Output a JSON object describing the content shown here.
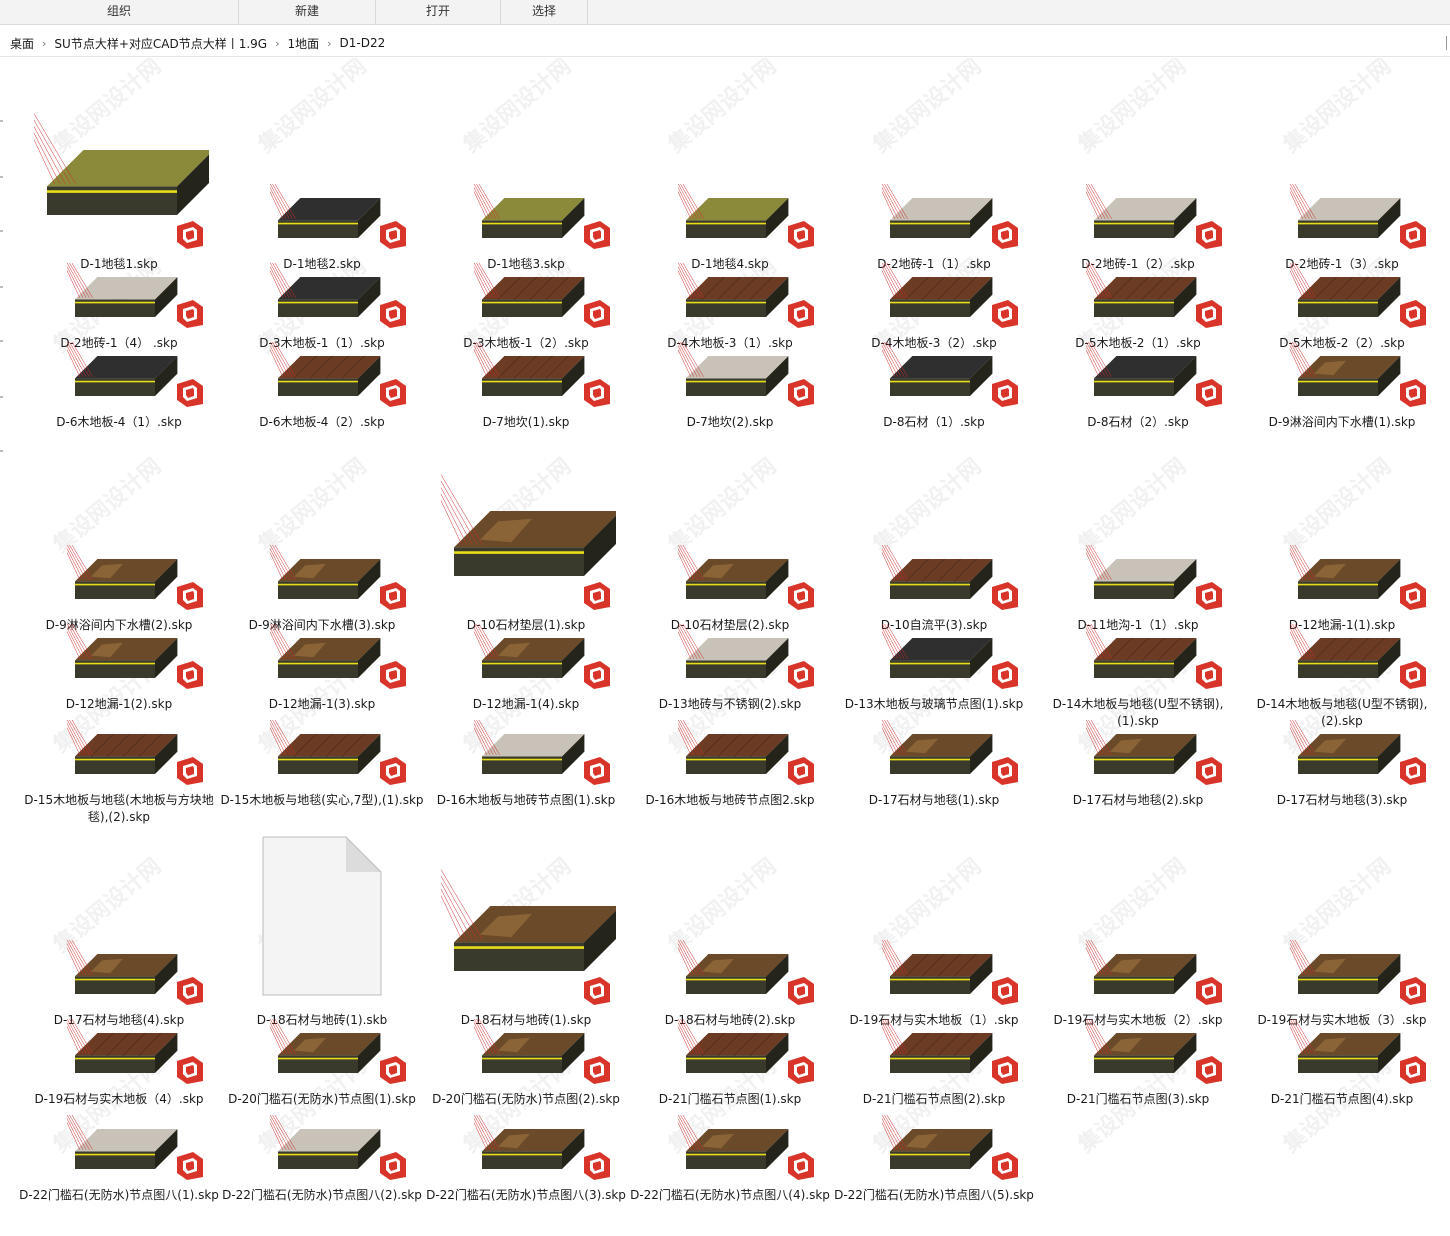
{
  "toolbar": {
    "items": [
      "组织",
      "新建",
      "打开",
      "选择"
    ]
  },
  "breadcrumb": [
    "桌面",
    "SU节点大样+对应CAD节点大样丨1.9G",
    "1地面",
    "D1-D22"
  ],
  "colors": {
    "concrete": "#3a3a2c",
    "insulation": "#e8dd18",
    "marble": "#6b4a2a",
    "wood": "#6b3b24",
    "carpet": "#8a8a3a",
    "tile": "#c8c2b8",
    "leader_lines": "#d12b2b",
    "sketchup_red": "#d9342a"
  },
  "files": [
    {
      "name": "D-1地毯1.skp",
      "thumb": "carpet"
    },
    {
      "name": "D-1地毯2.skp",
      "thumb": "dark"
    },
    {
      "name": "D-1地毯3.skp",
      "thumb": "carpet"
    },
    {
      "name": "D-1地毯4.skp",
      "thumb": "carpet"
    },
    {
      "name": "D-2地砖-1（1）.skp",
      "thumb": "tile"
    },
    {
      "name": "D-2地砖-1（2）.skp",
      "thumb": "tile"
    },
    {
      "name": "D-2地砖-1（3）.skp",
      "thumb": "tile"
    },
    {
      "name": "D-2地砖-1（4） .skp",
      "thumb": "tile"
    },
    {
      "name": "D-3木地板-1（1）.skp",
      "thumb": "dark"
    },
    {
      "name": "D-3木地板-1（2）.skp",
      "thumb": "wood"
    },
    {
      "name": "D-4木地板-3（1）.skp",
      "thumb": "wood"
    },
    {
      "name": "D-4木地板-3（2）.skp",
      "thumb": "wood"
    },
    {
      "name": "D-5木地板-2（1）.skp",
      "thumb": "wood"
    },
    {
      "name": "D-5木地板-2（2）.skp",
      "thumb": "wood"
    },
    {
      "name": "D-6木地板-4（1）.skp",
      "thumb": "dark"
    },
    {
      "name": "D-6木地板-4（2）.skp",
      "thumb": "wood"
    },
    {
      "name": "D-7地坎(1).skp",
      "thumb": "wood"
    },
    {
      "name": "D-7地坎(2).skp",
      "thumb": "tile"
    },
    {
      "name": "D-8石材（1）.skp",
      "thumb": "dark"
    },
    {
      "name": "D-8石材（2）.skp",
      "thumb": "dark"
    },
    {
      "name": "D-9淋浴间内下水槽(1).skp",
      "thumb": "marble"
    },
    {
      "name": "D-9淋浴间内下水槽(2).skp",
      "thumb": "marble"
    },
    {
      "name": "D-9淋浴间内下水槽(3).skp",
      "thumb": "marble"
    },
    {
      "name": "D-10石材垫层(1).skp",
      "thumb": "marble"
    },
    {
      "name": "D-10石材垫层(2).skp",
      "thumb": "marble"
    },
    {
      "name": "D-10自流平(3).skp",
      "thumb": "wood"
    },
    {
      "name": "D-11地沟-1（1）.skp",
      "thumb": "tile"
    },
    {
      "name": "D-12地漏-1(1).skp",
      "thumb": "marble"
    },
    {
      "name": "D-12地漏-1(2).skp",
      "thumb": "marble"
    },
    {
      "name": "D-12地漏-1(3).skp",
      "thumb": "marble"
    },
    {
      "name": "D-12地漏-1(4).skp",
      "thumb": "marble"
    },
    {
      "name": "D-13地砖与不锈钢(2).skp",
      "thumb": "tile"
    },
    {
      "name": "D-13木地板与玻璃节点图(1).skp",
      "thumb": "dark"
    },
    {
      "name": "D-14木地板与地毯(U型不锈钢),(1).skp",
      "thumb": "wood"
    },
    {
      "name": "D-14木地板与地毯(U型不锈钢),(2).skp",
      "thumb": "wood"
    },
    {
      "name": "D-15木地板与地毯(木地板与方块地毯),(2).skp",
      "thumb": "wood"
    },
    {
      "name": "D-15木地板与地毯(实心,7型),(1).skp",
      "thumb": "wood"
    },
    {
      "name": "D-16木地板与地砖节点图(1).skp",
      "thumb": "tile"
    },
    {
      "name": "D-16木地板与地砖节点图2.skp",
      "thumb": "wood"
    },
    {
      "name": "D-17石材与地毯(1).skp",
      "thumb": "marble"
    },
    {
      "name": "D-17石材与地毯(2).skp",
      "thumb": "marble"
    },
    {
      "name": "D-17石材与地毯(3).skp",
      "thumb": "marble"
    },
    {
      "name": "D-17石材与地毯(4).skp",
      "thumb": "marble"
    },
    {
      "name": "D-18石材与地砖(1).skb",
      "thumb": "blank"
    },
    {
      "name": "D-18石材与地砖(1).skp",
      "thumb": "marble"
    },
    {
      "name": "D-18石材与地砖(2).skp",
      "thumb": "marble"
    },
    {
      "name": "D-19石材与实木地板（1）.skp",
      "thumb": "wood"
    },
    {
      "name": "D-19石材与实木地板（2）.skp",
      "thumb": "marble"
    },
    {
      "name": "D-19石材与实木地板（3）.skp",
      "thumb": "marble"
    },
    {
      "name": "D-19石材与实木地板（4）.skp",
      "thumb": "wood"
    },
    {
      "name": "D-20门槛石(无防水)节点图(1).skp",
      "thumb": "marble"
    },
    {
      "name": "D-20门槛石(无防水)节点图(2).skp",
      "thumb": "marble"
    },
    {
      "name": "D-21门槛石节点图(1).skp",
      "thumb": "wood"
    },
    {
      "name": "D-21门槛石节点图(2).skp",
      "thumb": "wood"
    },
    {
      "name": "D-21门槛石节点图(3).skp",
      "thumb": "marble"
    },
    {
      "name": "D-21门槛石节点图(4).skp",
      "thumb": "marble"
    },
    {
      "name": "D-22门槛石(无防水)节点图八(1).skp",
      "thumb": "tile"
    },
    {
      "name": "D-22门槛石(无防水)节点图八(2).skp",
      "thumb": "tile"
    },
    {
      "name": "D-22门槛石(无防水)节点图八(3).skp",
      "thumb": "marble"
    },
    {
      "name": "D-22门槛石(无防水)节点图八(4).skp",
      "thumb": "marble"
    },
    {
      "name": "D-22门槛石(无防水)节点图八(5).skp",
      "thumb": "marble"
    }
  ]
}
